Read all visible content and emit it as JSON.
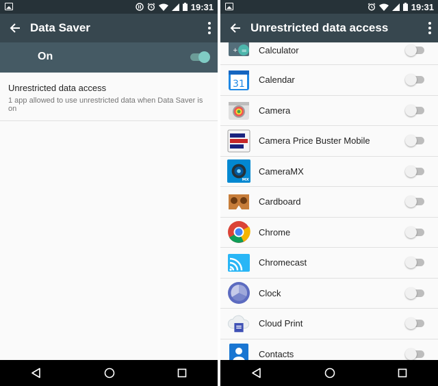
{
  "left": {
    "status": {
      "time": "19:31"
    },
    "appbar": {
      "title": "Data Saver"
    },
    "data_saver": {
      "label": "On",
      "enabled": true,
      "accent": "#80cbc4"
    },
    "pref": {
      "title": "Unrestricted data access",
      "summary": "1 app allowed to use unrestricted data when Data Saver is on"
    }
  },
  "right": {
    "status": {
      "time": "19:31"
    },
    "appbar": {
      "title": "Unrestricted data access"
    },
    "apps": [
      {
        "name": "Calculator",
        "icon": "calculator-icon",
        "enabled": false
      },
      {
        "name": "Calendar",
        "icon": "calendar-icon",
        "icon_text": "31",
        "enabled": false
      },
      {
        "name": "Camera",
        "icon": "camera-icon",
        "enabled": false
      },
      {
        "name": "Camera Price Buster Mobile",
        "icon": "camera-price-buster-icon",
        "enabled": false
      },
      {
        "name": "CameraMX",
        "icon": "cameramx-icon",
        "icon_text": "MX",
        "enabled": false
      },
      {
        "name": "Cardboard",
        "icon": "cardboard-icon",
        "enabled": false
      },
      {
        "name": "Chrome",
        "icon": "chrome-icon",
        "enabled": false
      },
      {
        "name": "Chromecast",
        "icon": "chromecast-icon",
        "enabled": false
      },
      {
        "name": "Clock",
        "icon": "clock-icon",
        "enabled": false
      },
      {
        "name": "Cloud Print",
        "icon": "cloud-print-icon",
        "enabled": false
      },
      {
        "name": "Contacts",
        "icon": "contacts-icon",
        "enabled": false
      }
    ]
  },
  "colors": {
    "status_bar": "#263238",
    "app_bar": "#37474f",
    "toggle_bar": "#455a64",
    "background": "#fafafa"
  }
}
